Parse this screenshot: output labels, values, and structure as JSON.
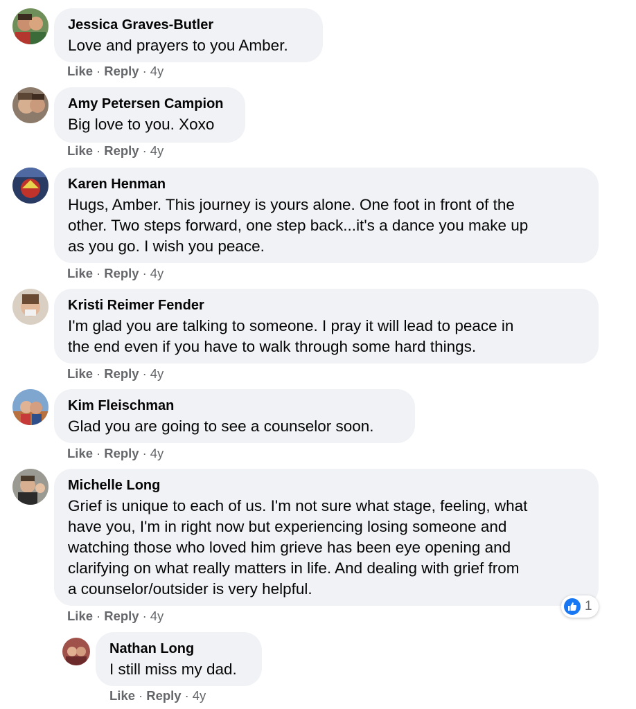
{
  "comments": [
    {
      "author": "Jessica Graves-Butler",
      "text": "Love and prayers to you Amber.",
      "like": "Like",
      "reply": "Reply",
      "time": "4y"
    },
    {
      "author": "Amy Petersen Campion",
      "text": "Big love to you. Xoxo",
      "like": "Like",
      "reply": "Reply",
      "time": "4y"
    },
    {
      "author": "Karen Henman",
      "text_lines": [
        "Hugs, Amber. This journey is yours alone. One foot in front of the",
        "other. Two steps forward, one step back...it's a dance you make up",
        "as you go. I wish you peace."
      ],
      "like": "Like",
      "reply": "Reply",
      "time": "4y"
    },
    {
      "author": "Kristi Reimer Fender",
      "text_lines": [
        "I'm glad you are talking to someone. I pray it will lead to peace in",
        "the end even if you have to walk through some hard things."
      ],
      "like": "Like",
      "reply": "Reply",
      "time": "4y"
    },
    {
      "author": "Kim Fleischman",
      "text": "Glad you are going to see a counselor soon.",
      "like": "Like",
      "reply": "Reply",
      "time": "4y"
    },
    {
      "author": "Michelle Long",
      "text_lines": [
        "Grief is unique to each of us. I'm not sure what stage, feeling, what",
        "have you, I'm in right now but experiencing losing someone and",
        "watching those who loved him grieve has been eye opening and",
        "clarifying on what really matters in life. And dealing with grief from",
        "a counselor/outsider is very helpful."
      ],
      "like": "Like",
      "reply": "Reply",
      "time": "4y",
      "reaction": {
        "icon": "like-reaction-icon",
        "count": "1",
        "color": "#1877f2"
      }
    }
  ],
  "reply": {
    "author": "Nathan Long",
    "text": "I still miss my dad.",
    "like": "Like",
    "reply": "Reply",
    "time": "4y"
  },
  "separator": "·",
  "colors": {
    "bubble": "#f0f2f5",
    "meta": "#65676b",
    "text": "#050505"
  }
}
